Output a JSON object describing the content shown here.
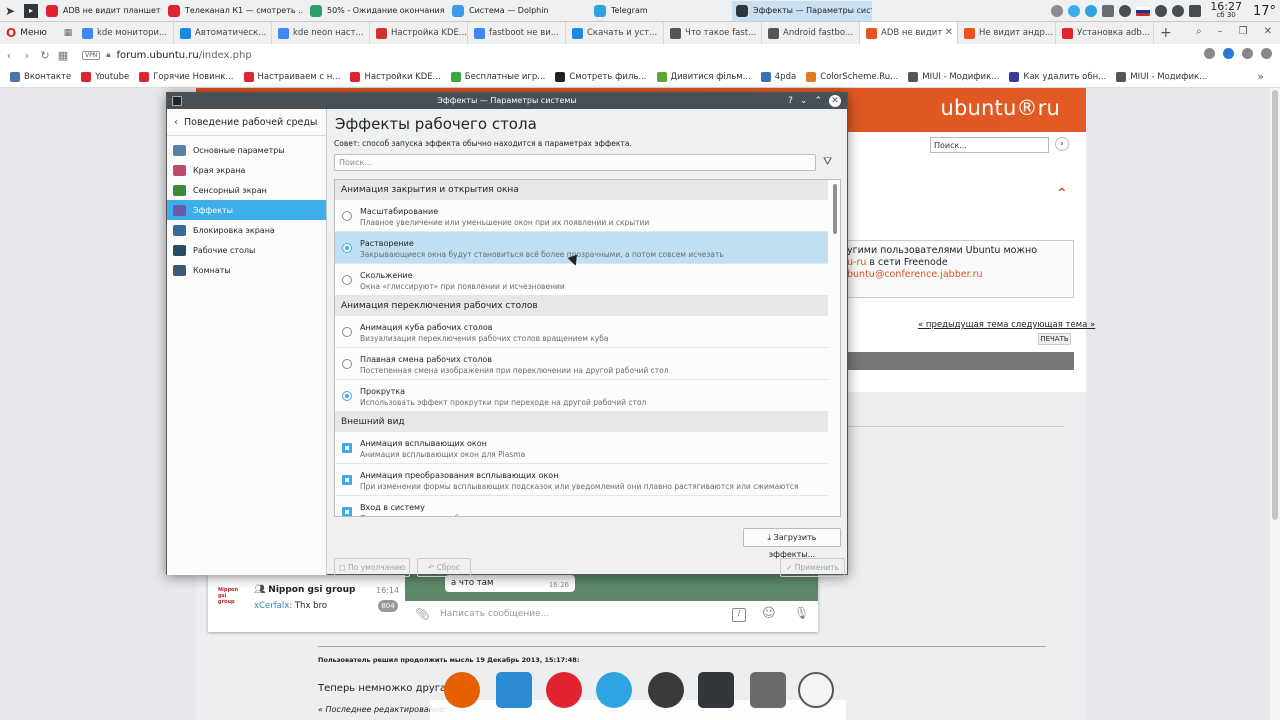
{
  "taskbar": {
    "tasks": [
      {
        "label": "ADB не видит планшет An...",
        "icon_color": "#e0232e",
        "sound": true
      },
      {
        "label": "Телеканал К1 — смотреть ...",
        "icon_color": "#e0232e",
        "sound": true
      },
      {
        "label": "50% - Ожидание окончания опе...",
        "icon_color": "#2e9f6b",
        "sound": false
      },
      {
        "label": "Система — Dolphin",
        "icon_color": "#3d9ae8",
        "sound": false
      },
      {
        "label": "Telegram",
        "icon_color": "#2ea5e0",
        "sound": false
      },
      {
        "label": "Эффекты — Параметры системы",
        "icon_color": "#31363b",
        "sound": false,
        "active": true
      }
    ],
    "clock_time": "16:27",
    "clock_date": "сб 30",
    "temperature": "17°"
  },
  "browser": {
    "menu_label": "Меню",
    "tabs": [
      {
        "label": "kde монитори...",
        "fav": "#4285f4"
      },
      {
        "label": "Автоматическ...",
        "fav": "#1e88e5"
      },
      {
        "label": "kde neon наст...",
        "fav": "#4285f4"
      },
      {
        "label": "Настройка KDE...",
        "fav": "#d32f2f"
      },
      {
        "label": "fastboot не ви...",
        "fav": "#4285f4"
      },
      {
        "label": "Скачать и уст...",
        "fav": "#1e88e5"
      },
      {
        "label": "Что такое fast...",
        "fav": "#555555"
      },
      {
        "label": "Android fastbo...",
        "fav": "#555555"
      },
      {
        "label": "ADB не видит",
        "fav": "#e95420",
        "active": true
      },
      {
        "label": "Не видит андр...",
        "fav": "#e95420"
      },
      {
        "label": "Установка adb...",
        "fav": "#e0232e"
      }
    ],
    "vpn_label": "VPN",
    "url_domain": "forum.ubuntu.ru",
    "url_path": "/index.php",
    "bookmarks": [
      {
        "label": "Вконтакте",
        "color": "#4a76a8"
      },
      {
        "label": "Youtube",
        "color": "#e0232e"
      },
      {
        "label": "Горячие Новинк...",
        "color": "#e0232e"
      },
      {
        "label": "Настраиваем с н...",
        "color": "#e0232e"
      },
      {
        "label": "Настройки KDE...",
        "color": "#e0232e"
      },
      {
        "label": "Бесплатные игр...",
        "color": "#3aa83a"
      },
      {
        "label": "Смотреть филь...",
        "color": "#222222"
      },
      {
        "label": "Дивитися фільм...",
        "color": "#5aa82a"
      },
      {
        "label": "4pda",
        "color": "#3b6fb6"
      },
      {
        "label": "ColorScheme.Ru...",
        "color": "#e07b22"
      },
      {
        "label": "MIUI - Модифик...",
        "color": "#555555"
      },
      {
        "label": "Как удалить обн...",
        "color": "#3a3a9a"
      },
      {
        "label": "MIUI - Модифик...",
        "color": "#555555"
      }
    ]
  },
  "webpage": {
    "logo": "ubuntu®ru",
    "search_placeholder": "Поиск...",
    "irc_line1": "угими пользователями Ubuntu можно",
    "irc_line2_a": "u-ru",
    "irc_line2_b": " в сети Freenode",
    "irc_line3": "buntu@conference.jabber.ru",
    "prevnext": "« предыдущая тема следующая тема »",
    "print": "ПЕЧАТЬ",
    "post_meta": "Пользователь решил продолжить мысль 19 Декабрь 2013, 15:17:48:",
    "post_text": "Теперь немножко другая про",
    "post_edit": "« Последнее редактирование:"
  },
  "telegram": {
    "chat_title": "Nippon gsi group",
    "chat_time": "16:14",
    "avatar_text": "Nippon gsi group",
    "last_user": "xCerfalx:",
    "last_text": " Thx bro",
    "badge": "804",
    "bubble_text": "а что там",
    "bubble_time": "16:26",
    "input_placeholder": "Написать сообщение..."
  },
  "dialog": {
    "title": "Эффекты — Параметры системы",
    "help": "?",
    "back_label": "Поведение рабочей среды",
    "sidebar": [
      {
        "label": "Основные параметры",
        "color": "#5a7fa8"
      },
      {
        "label": "Края экрана",
        "color": "#c04a6a"
      },
      {
        "label": "Сенсорный экран",
        "color": "#3a8a3a"
      },
      {
        "label": "Эффекты",
        "color": "#6a5aa8",
        "selected": true
      },
      {
        "label": "Блокировка экрана",
        "color": "#3a6a9a"
      },
      {
        "label": "Рабочие столы",
        "color": "#2a4a6a"
      },
      {
        "label": "Комнаты",
        "color": "#3a5a7a"
      }
    ],
    "heading": "Эффекты рабочего стола",
    "hint": "Совет: способ запуска эффекта обычно находится в параметрах эффекта.",
    "search_placeholder": "Поиск...",
    "categories": [
      {
        "title": "Анимация закрытия и открытия окна",
        "items": [
          {
            "name": "Масштабирование",
            "desc": "Плавное увеличение или уменьшение окон при их появлении и скрытии",
            "type": "radio",
            "on": false
          },
          {
            "name": "Растворение",
            "desc": "Закрывающиеся окна будут становиться всё более прозрачными, а потом совсем исчезать",
            "type": "radio",
            "on": true,
            "highlight": true
          },
          {
            "name": "Скольжение",
            "desc": "Окна «глиссируют» при появлении и исчезновении",
            "type": "radio",
            "on": false
          }
        ]
      },
      {
        "title": "Анимация переключения рабочих столов",
        "items": [
          {
            "name": "Анимация куба рабочих столов",
            "desc": "Визуализация переключения рабочих столов вращением куба",
            "type": "radio",
            "on": false
          },
          {
            "name": "Плавная смена рабочих столов",
            "desc": "Постепенная смена изображения при переключении на другой рабочий стол",
            "type": "radio",
            "on": false
          },
          {
            "name": "Прокрутка",
            "desc": "Использовать эффект прокрутки при переходе на другой рабочий стол",
            "type": "radio",
            "on": true
          }
        ]
      },
      {
        "title": "Внешний вид",
        "items": [
          {
            "name": "Анимация всплывающих окон",
            "desc": "Анимация всплывающих окон для Plasma",
            "type": "check",
            "on": true
          },
          {
            "name": "Анимация преобразования всплывающих окон",
            "desc": "При изменении формы всплывающих подсказок или уведомлений они плавно растягиваются или сжимаются",
            "type": "check",
            "on": true
          },
          {
            "name": "Вход в систему",
            "desc": "Плавное проявление рабочего стола при входе в систему",
            "type": "check",
            "on": true
          }
        ]
      }
    ],
    "load_button": "Загрузить эффекты...",
    "defaults_button": "По умолчанию",
    "reset_button": "Сброс",
    "apply_button": "Применить"
  },
  "dock": {
    "icons": [
      {
        "name": "firefox",
        "color": "#e66000"
      },
      {
        "name": "files",
        "color": "#2a8ad4"
      },
      {
        "name": "opera",
        "color": "#e0232e"
      },
      {
        "name": "telegram",
        "color": "#2ea5e0"
      },
      {
        "name": "progress",
        "color": "#3a3a3a"
      },
      {
        "name": "settings",
        "color": "#31363b"
      },
      {
        "name": "screenshot",
        "color": "#6a6a6a"
      },
      {
        "name": "clock",
        "color": "#f4f4f4"
      }
    ]
  }
}
